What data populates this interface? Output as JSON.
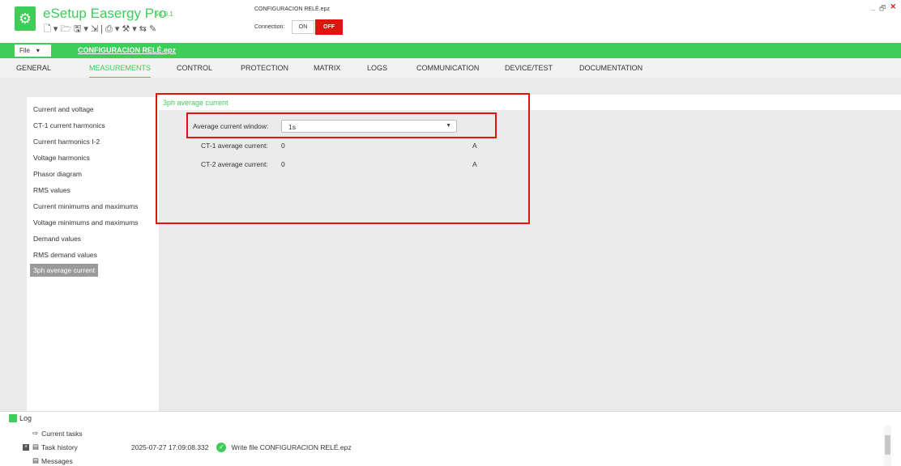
{
  "app": {
    "name": "eSetup Easergy Pro",
    "version": "v4.9.1",
    "file_title": "CONFIGURACION RELÉ.epz",
    "connection_label": "Connection:",
    "on_label": "ON",
    "off_label": "OFF",
    "window_controls": {
      "minimize": "_",
      "restore": "🗗",
      "close": "✕"
    }
  },
  "toolbar": {
    "icons": [
      "new-file-icon",
      "open-folder-icon",
      "save-icon",
      "export-icon",
      "print-icon",
      "tools-icon",
      "compare-icon",
      "edit-icon"
    ]
  },
  "filebar": {
    "file_menu": "File",
    "file_tab": "CONFIGURACION RELÉ.epz"
  },
  "tabs": [
    "GENERAL",
    "MEASUREMENTS",
    "CONTROL",
    "PROTECTION",
    "MATRIX",
    "LOGS",
    "COMMUNICATION",
    "DEVICE/TEST",
    "DOCUMENTATION"
  ],
  "active_tab": "MEASUREMENTS",
  "sidebar": {
    "items": [
      "Current and voltage",
      "CT-1 current harmonics",
      "Current harmonics I-2",
      "Voltage harmonics",
      "Phasor diagram",
      "RMS values",
      "Current minimums and maximums",
      "Voltage minimums and maximums",
      "Demand values",
      "RMS demand values",
      "3ph average current"
    ],
    "active": "3ph average current"
  },
  "panel": {
    "title": "3ph average current",
    "window_label": "Average current window:",
    "window_value": "1s",
    "rows": [
      {
        "label": "CT-1 average current:",
        "value": "0",
        "unit": "A"
      },
      {
        "label": "CT-2 average current:",
        "value": "0",
        "unit": "A"
      }
    ]
  },
  "log": {
    "title": "Log",
    "current_tasks": "Current tasks",
    "task_history": "Task history",
    "messages": "Messages",
    "entry_timestamp": "2025-07-27 17:09:08.332",
    "entry_text": "Write file CONFIGURACION RELÉ.epz"
  },
  "colors": {
    "accent": "#3dcd58",
    "alert": "#e0140e"
  }
}
